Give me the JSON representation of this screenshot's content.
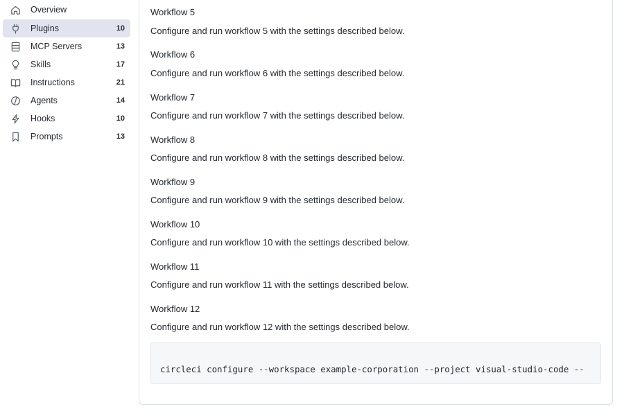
{
  "sidebar": {
    "items": [
      {
        "label": "Overview",
        "count": "",
        "icon": "home-icon"
      },
      {
        "label": "Plugins",
        "count": "10",
        "icon": "plug-icon",
        "active": true
      },
      {
        "label": "MCP Servers",
        "count": "13",
        "icon": "server-icon"
      },
      {
        "label": "Skills",
        "count": "17",
        "icon": "lightbulb-icon"
      },
      {
        "label": "Instructions",
        "count": "21",
        "icon": "book-icon"
      },
      {
        "label": "Agents",
        "count": "14",
        "icon": "agent-icon"
      },
      {
        "label": "Hooks",
        "count": "10",
        "icon": "lightning-icon"
      },
      {
        "label": "Prompts",
        "count": "13",
        "icon": "bookmark-icon"
      }
    ]
  },
  "main": {
    "workflows": [
      {
        "title": "Workflow 5",
        "description": "Configure and run workflow 5 with the settings described below."
      },
      {
        "title": "Workflow 6",
        "description": "Configure and run workflow 6 with the settings described below."
      },
      {
        "title": "Workflow 7",
        "description": "Configure and run workflow 7 with the settings described below."
      },
      {
        "title": "Workflow 8",
        "description": "Configure and run workflow 8 with the settings described below."
      },
      {
        "title": "Workflow 9",
        "description": "Configure and run workflow 9 with the settings described below."
      },
      {
        "title": "Workflow 10",
        "description": "Configure and run workflow 10 with the settings described below."
      },
      {
        "title": "Workflow 11",
        "description": "Configure and run workflow 11 with the settings described below."
      },
      {
        "title": "Workflow 12",
        "description": "Configure and run workflow 12 with the settings described below."
      }
    ],
    "code": "circleci configure --workspace example-corporation --project visual-studio-code --"
  },
  "colors": {
    "active_bg": "#e1e4ee",
    "text": "#24292f",
    "muted": "#57606a",
    "border": "#d8dee4",
    "code_bg": "#f6f7f8"
  }
}
